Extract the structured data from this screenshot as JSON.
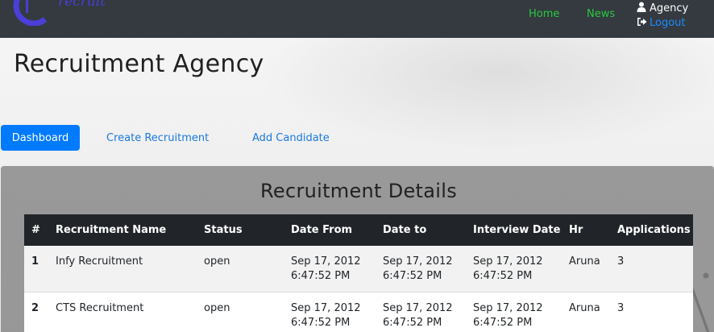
{
  "navbar": {
    "brand_text": "recruit",
    "links": [
      {
        "label": "Home"
      },
      {
        "label": "News"
      }
    ],
    "user": {
      "name": "Agency",
      "logout_label": "Logout"
    }
  },
  "page": {
    "title": "Recruitment Agency"
  },
  "tabs": [
    {
      "label": "Dashboard",
      "active": true
    },
    {
      "label": "Create Recruitment",
      "active": false
    },
    {
      "label": "Add Candidate",
      "active": false
    }
  ],
  "panel": {
    "title": "Recruitment Details"
  },
  "table": {
    "headers": [
      "#",
      "Recruitment Name",
      "Status",
      "Date From",
      "Date to",
      "Interview Date",
      "Hr",
      "Applications"
    ],
    "rows": [
      {
        "index": "1",
        "name": "Infy Recruitment",
        "status": "open",
        "date_from": [
          "Sep 17, 2012",
          "6:47:52 PM"
        ],
        "date_to": [
          "Sep 17, 2012",
          "6:47:52 PM"
        ],
        "interview_date": [
          "Sep 17, 2012",
          "6:47:52 PM"
        ],
        "hr": "Aruna",
        "applications": "3"
      },
      {
        "index": "2",
        "name": "CTS Recruitment",
        "status": "open",
        "date_from": [
          "Sep 17, 2012",
          "6:47:52 PM"
        ],
        "date_to": [
          "Sep 17, 2012",
          "6:47:52 PM"
        ],
        "interview_date": [
          "Sep 17, 2012",
          "6:47:52 PM"
        ],
        "hr": "Aruna",
        "applications": "3"
      }
    ]
  },
  "colors": {
    "navbar": "#343a40",
    "nav_link": "#28c940",
    "primary": "#007bff",
    "link": "#1a7ae0",
    "table_header": "#212529"
  },
  "icons": {
    "user": "user-icon",
    "logout": "sign-out-icon",
    "logo": "logo-icon"
  }
}
